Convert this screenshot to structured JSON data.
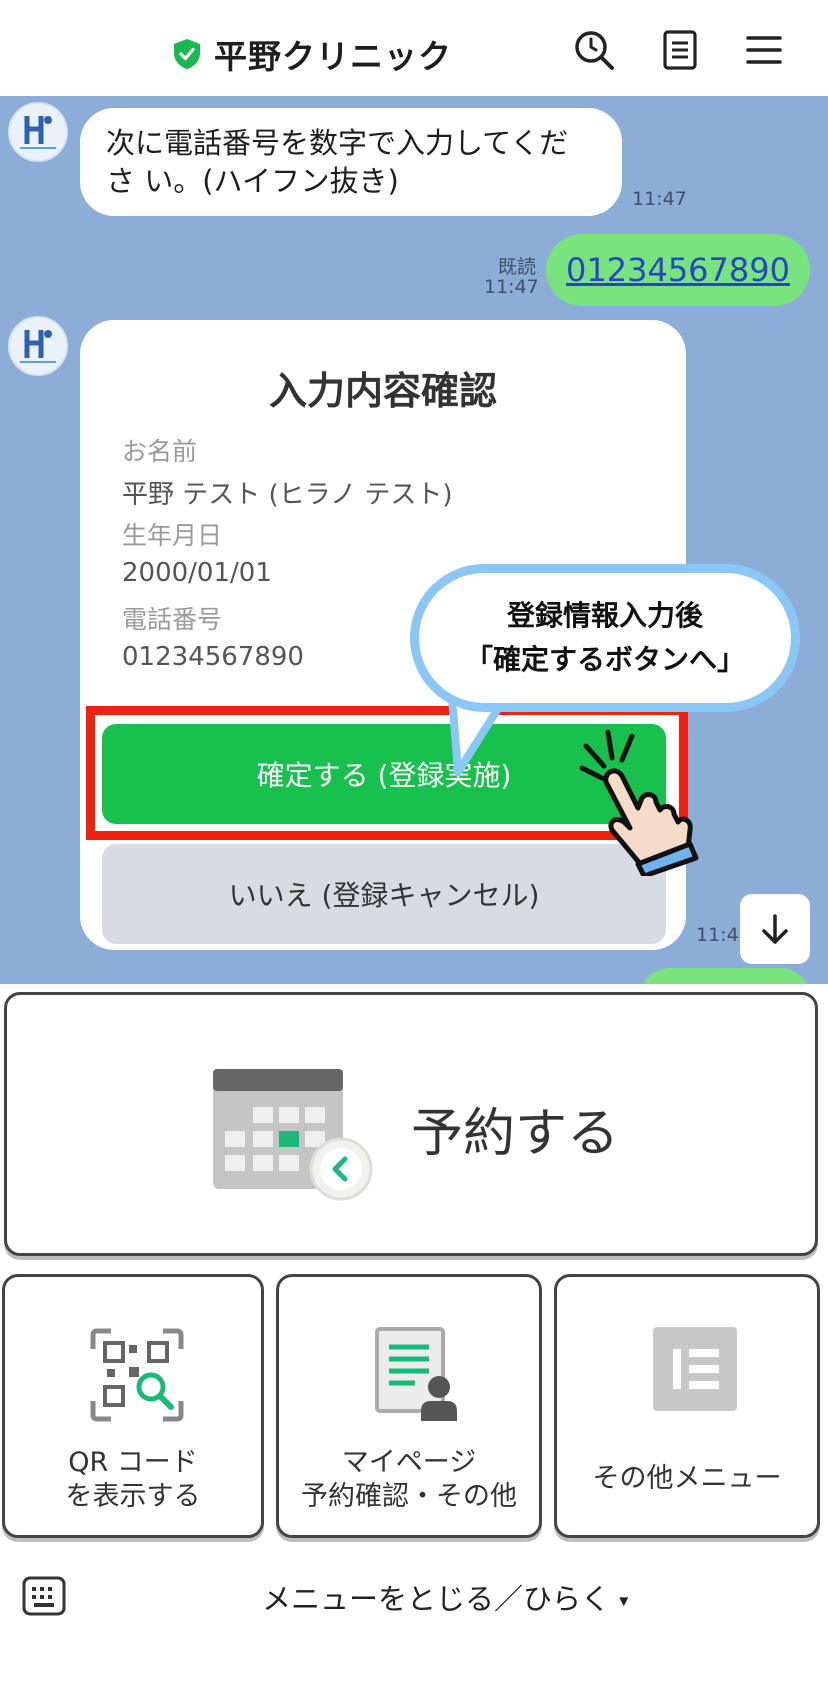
{
  "header": {
    "title": "平野クリニック",
    "icons": [
      "verified-shield-icon",
      "search-icon",
      "notes-icon",
      "hamburger-menu-icon"
    ],
    "shield_color": "#19b94d"
  },
  "chat": {
    "background": "#8badd8",
    "messages": [
      {
        "from": "clinic",
        "text": "次に電話番号を数字で入力してくださ い。(ハイフン抜き)",
        "time": "11:47"
      },
      {
        "from": "user",
        "text": "01234567890",
        "read_label": "既読",
        "time": "11:47"
      }
    ],
    "confirm_card": {
      "title": "入力内容確認",
      "fields": [
        {
          "label": "お名前",
          "value": "平野 テスト (ヒラノ テスト)"
        },
        {
          "label": "生年月日",
          "value": "2000/01/01"
        },
        {
          "label": "電話番号",
          "value": "01234567890"
        }
      ],
      "confirm_button": "確定する (登録実施)",
      "cancel_button": "いいえ (登録キャンセル)",
      "time": "11:47"
    },
    "callout": {
      "line1": "登録情報入力後",
      "line2": "「確定するボタンへ」"
    },
    "colors": {
      "confirm": "#18c14e",
      "highlight": "#f0220f",
      "callout_border": "#8ac7f5"
    }
  },
  "rich_menu": {
    "reserve": {
      "label": "予約する",
      "icon": "calendar-icon"
    },
    "tiles": [
      {
        "line1": "QR コード",
        "line2": "を表示する",
        "icon": "qr-code-search-icon"
      },
      {
        "line1": "マイページ",
        "line2": "予約確認・その他",
        "icon": "mypage-document-icon"
      },
      {
        "line1": "その他メニュー",
        "icon": "other-menu-icon"
      }
    ]
  },
  "bottom_bar": {
    "label": "メニューをとじる／ひらく",
    "caret": "▾",
    "icon": "keyboard-icon"
  }
}
